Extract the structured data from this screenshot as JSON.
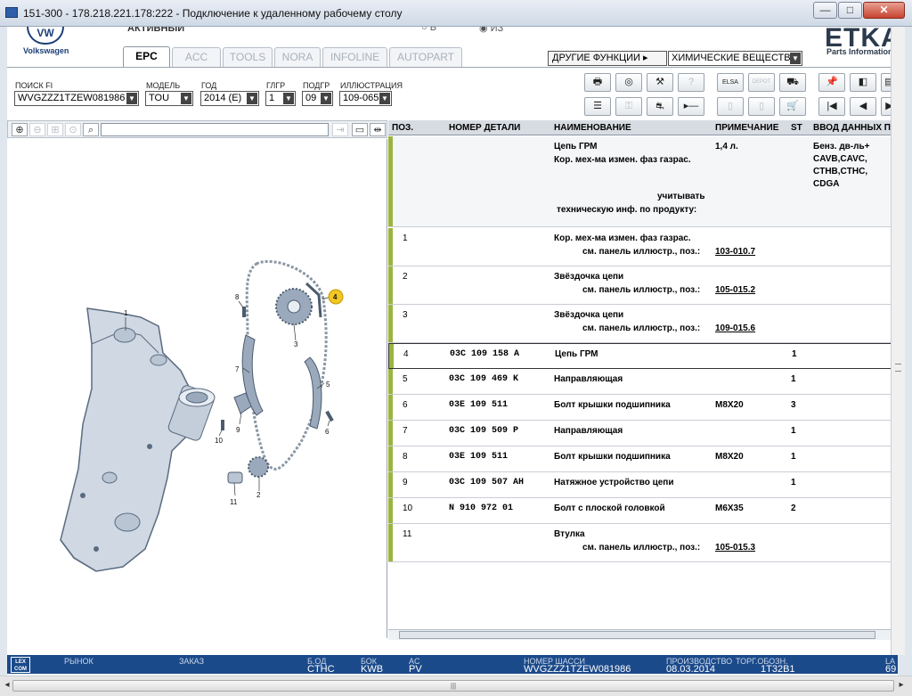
{
  "window": {
    "title": "151-300 - 178.218.221.178:222 - Подключение к удаленному рабочему столу",
    "min": "—",
    "max": "□",
    "close": "✕"
  },
  "header": {
    "brand_label": "Volkswagen",
    "brand_mark": "VW",
    "status": "АКТИВНЫЙ",
    "radio_a": "○ В",
    "radio_b": "◉ ИЗ",
    "etka_logo": "ETKA",
    "etka_sub": "Parts Information"
  },
  "tabs": [
    "EPC",
    "ACC",
    "TOOLS",
    "NORA",
    "INFOLINE",
    "AUTOPART"
  ],
  "functions": {
    "button": "ДРУГИЕ ФУНКЦИИ ▸",
    "select_value": "ХИМИЧЕСКИЕ ВЕЩЕСТВА"
  },
  "filters": {
    "search_fi": {
      "label": "ПОИСК FI",
      "value": "WVGZZZ1TZEW081986"
    },
    "model": {
      "label": "МОДЕЛЬ",
      "value": "TOU"
    },
    "year": {
      "label": "ГОД",
      "value": "2014 (E)"
    },
    "main_group": {
      "label": "ГЛГР",
      "value": "1"
    },
    "sub_group": {
      "label": "ПОДГР",
      "value": "09"
    },
    "illustration": {
      "label": "ИЛЛЮСТРАЦИЯ",
      "value": "109-065"
    }
  },
  "toolbar_icons": {
    "print": "🖶",
    "cd": "◎",
    "tools": "⚒",
    "help": "?",
    "elsa": "ELSA",
    "depot": "DEPOT",
    "cart_in": "⛟",
    "pin": "📌",
    "prev_page": "◧",
    "next_page": "▤",
    "list": "☰",
    "key": "⚿",
    "car": "⛐",
    "step": "▸—",
    "doc": "▯",
    "doc2": "▯",
    "cart": "🛒",
    "first": "|◀",
    "prev": "◀",
    "next": "▶"
  },
  "table": {
    "columns": [
      "ПОЗ.",
      "НОМЕР ДЕТАЛИ",
      "НАИМЕНОВАНИЕ",
      "ПРИМЕЧАНИЕ",
      "ST",
      "ВВОД ДАННЫХ ПО"
    ],
    "header_row": {
      "name": "Цепь ГРМ",
      "name_line2": "Кор. мех-ма измен. фаз газрас.",
      "note": "1,4 л.",
      "input_lines": [
        "Бенз. дв-ль+",
        "CAVB,CAVC,",
        "CTHB,CTHC,",
        "CDGA"
      ],
      "hint_line1": "учитывать",
      "hint_line2": "техническую инф. по продукту:"
    },
    "rows": [
      {
        "pos": "1",
        "part": "",
        "name": "Кор. мех-ма измен. фаз газрас.",
        "name2": "см. панель иллюстр., поз.:",
        "link": "103-010.7",
        "note": "",
        "st": ""
      },
      {
        "pos": "2",
        "part": "",
        "name": "Звёздочка цепи",
        "name2": "см. панель иллюстр., поз.:",
        "link": "105-015.2",
        "note": "",
        "st": ""
      },
      {
        "pos": "3",
        "part": "",
        "name": "Звёздочка цепи",
        "name2": "см. панель иллюстр., поз.:",
        "link": "109-015.6",
        "note": "",
        "st": ""
      },
      {
        "pos": "4",
        "part": "03C  109  158  A",
        "name": "Цепь ГРМ",
        "name2": "",
        "link": "",
        "note": "",
        "st": "1"
      },
      {
        "pos": "5",
        "part": "03C  109  469  K",
        "name": "Направляющая",
        "name2": "",
        "link": "",
        "note": "",
        "st": "1"
      },
      {
        "pos": "6",
        "part": "03E  109  511",
        "name": "Болт крышки подшипника",
        "name2": "",
        "link": "",
        "note": "M8X20",
        "st": "3"
      },
      {
        "pos": "7",
        "part": "03C  109  509  P",
        "name": "Направляющая",
        "name2": "",
        "link": "",
        "note": "",
        "st": "1"
      },
      {
        "pos": "8",
        "part": "03E  109  511",
        "name": "Болт крышки подшипника",
        "name2": "",
        "link": "",
        "note": "M8X20",
        "st": "1"
      },
      {
        "pos": "9",
        "part": "03C  109  507  AH",
        "name": "Натяжное устройство цепи",
        "name2": "",
        "link": "",
        "note": "",
        "st": "1"
      },
      {
        "pos": "10",
        "part": "N    910  972  01",
        "name": "Болт с плоской головкой",
        "name2": "",
        "link": "",
        "note": "M6X35",
        "st": "2"
      },
      {
        "pos": "11",
        "part": "",
        "name": "Втулка",
        "name2": "см. панель иллюстр., поз.:",
        "link": "105-015.3",
        "note": "",
        "st": ""
      }
    ]
  },
  "callouts": [
    "1",
    "2",
    "3",
    "4",
    "5",
    "6",
    "7",
    "8",
    "9",
    "10",
    "11"
  ],
  "status": {
    "logo": "LEX COM",
    "market": "РЫНОК",
    "order": "ЗАКАЗ",
    "bod": {
      "label": "Б.ОД",
      "value": "CTHC"
    },
    "bok": {
      "label": "БОК",
      "value": "KWB"
    },
    "ac": {
      "label": "AC",
      "value": "PV"
    },
    "chassis": {
      "label": "НОМЕР ШАССИ",
      "value": "WVGZZZ1TZEW081986"
    },
    "production": {
      "label": "ПРОИЗВОДСТВО",
      "value": "08.03.2014"
    },
    "trade": {
      "label": "ТОРГ.ОБОЗН.",
      "value": "1T32B1"
    },
    "extra": {
      "label": "LA",
      "value": "69"
    }
  },
  "colors": {
    "accent_bar": "#9cb441",
    "status_bar": "#1b4a8a",
    "highlight": "#f3c623"
  }
}
